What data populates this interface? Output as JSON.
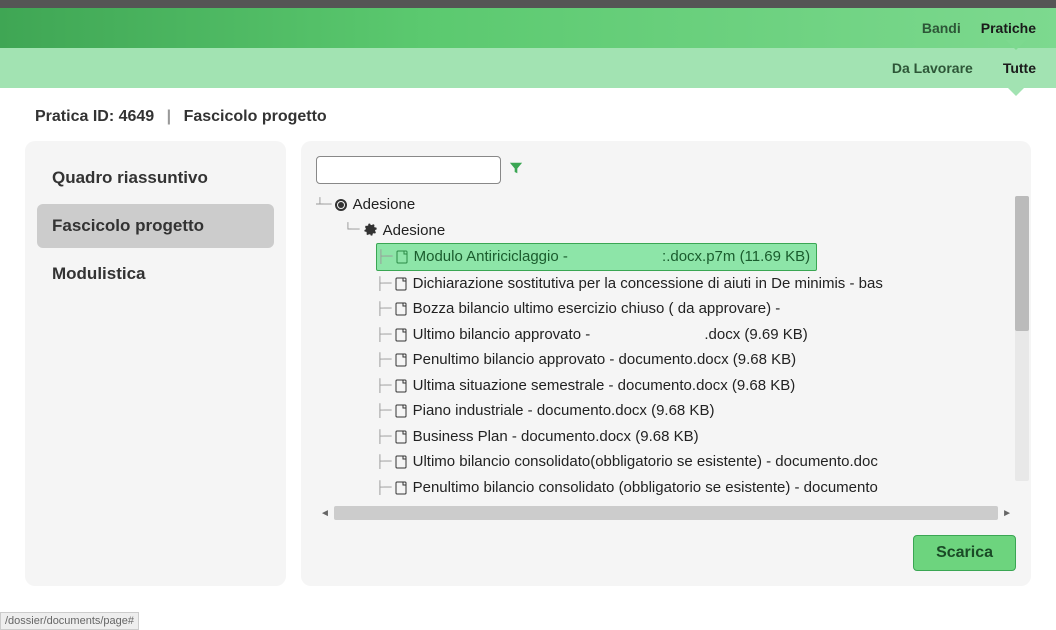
{
  "topnav": {
    "items": [
      {
        "label": "Bandi",
        "active": false
      },
      {
        "label": "Pratiche",
        "active": true
      }
    ]
  },
  "subnav": {
    "items": [
      {
        "label": "Da Lavorare",
        "active": false
      },
      {
        "label": "Tutte",
        "active": true
      }
    ]
  },
  "breadcrumb": {
    "left": "Pratica ID: 4649",
    "right": "Fascicolo progetto"
  },
  "sidebar": {
    "items": [
      {
        "label": "Quadro riassuntivo",
        "active": false
      },
      {
        "label": "Fascicolo progetto",
        "active": true
      },
      {
        "label": "Modulistica",
        "active": false
      }
    ]
  },
  "search": {
    "value": "",
    "placeholder": ""
  },
  "tree": {
    "root": {
      "label": "Adesione"
    },
    "child": {
      "label": "Adesione"
    },
    "files": [
      {
        "label_left": "Modulo Antiriciclaggio - ",
        "label_right": ":.docx.p7m (11.69 KB)",
        "selected": true
      },
      {
        "label": "Dichiarazione sostitutiva per la concessione di aiuti in De minimis - bas"
      },
      {
        "label": "Bozza bilancio ultimo esercizio chiuso ( da approvare) -"
      },
      {
        "label_left": "Ultimo bilancio approvato - ",
        "label_right": ".docx (9.69 KB)"
      },
      {
        "label": "Penultimo bilancio approvato - documento.docx (9.68 KB)"
      },
      {
        "label": "Ultima situazione semestrale - documento.docx (9.68 KB)"
      },
      {
        "label": "Piano industriale - documento.docx (9.68 KB)"
      },
      {
        "label": "Business Plan - documento.docx (9.68 KB)"
      },
      {
        "label": "Ultimo bilancio consolidato(obbligatorio se esistente) - documento.doc"
      },
      {
        "label": "Penultimo bilancio consolidato (obbligatorio se esistente) - documento"
      }
    ]
  },
  "buttons": {
    "download": "Scarica"
  },
  "status": "/dossier/documents/page#"
}
